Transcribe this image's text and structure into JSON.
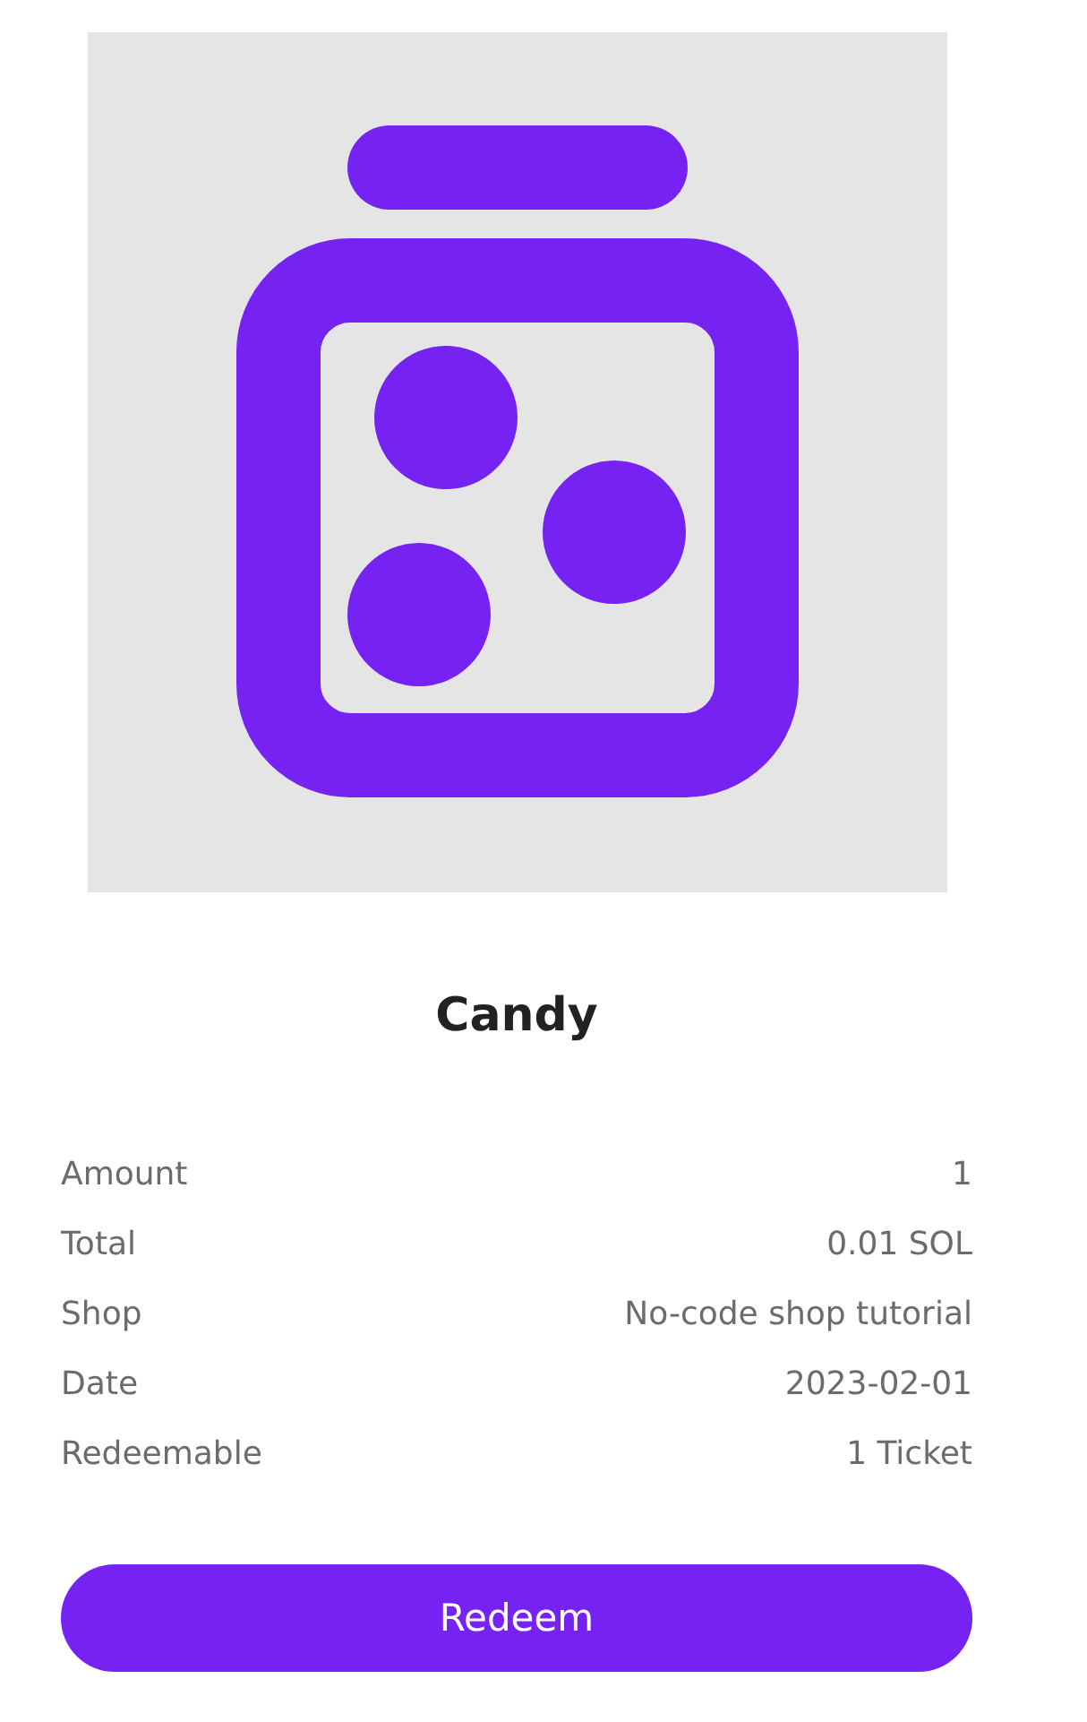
{
  "title": "Candy",
  "details": [
    {
      "label": "Amount",
      "value": "1"
    },
    {
      "label": "Total",
      "value": "0.01 SOL"
    },
    {
      "label": "Shop",
      "value": "No-code shop tutorial"
    },
    {
      "label": "Date",
      "value": "2023-02-01"
    },
    {
      "label": "Redeemable",
      "value": "1 Ticket"
    }
  ],
  "button": "Redeem"
}
